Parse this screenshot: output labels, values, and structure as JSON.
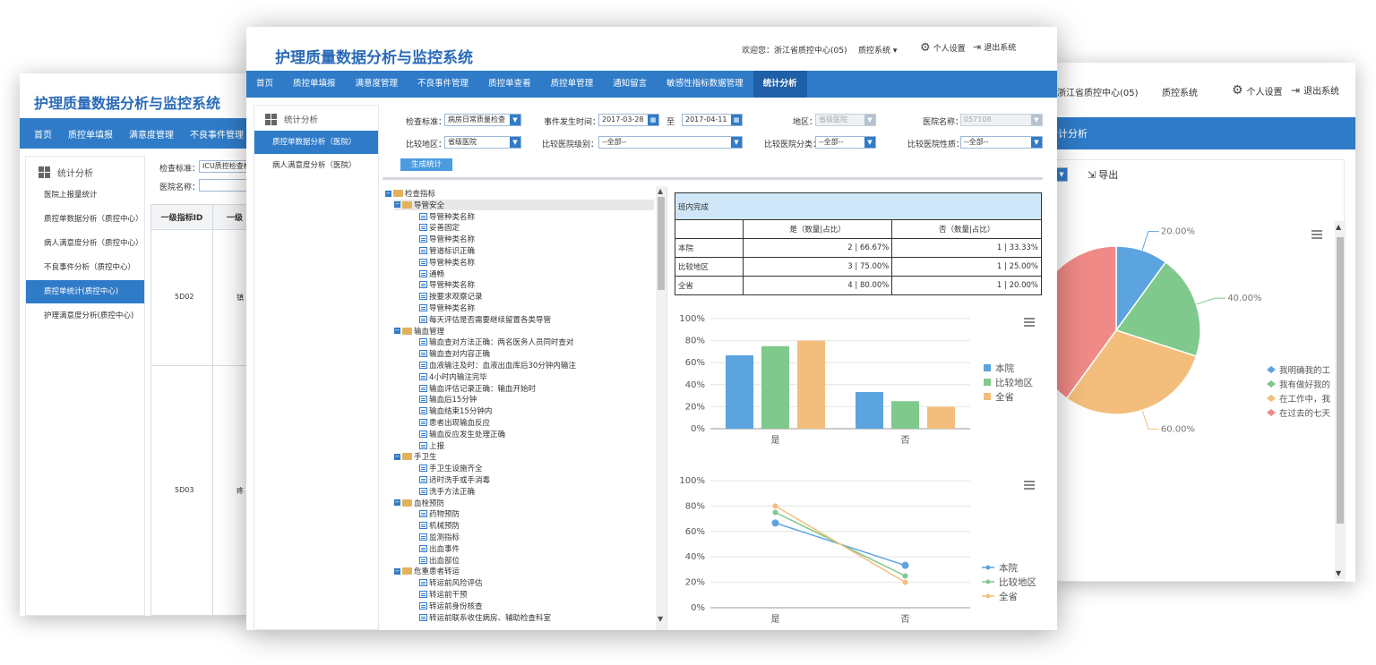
{
  "app_title": "护理质量数据分析与监控系统",
  "header": {
    "welcome": "欢迎您：浙江省质控中心(05)",
    "system_menu": "质控系统",
    "right_welcome": "浙江省质控中心(05)",
    "personal": "个人设置",
    "logout": "退出系统"
  },
  "nav": {
    "items": [
      "首页",
      "质控单填报",
      "满意度管理",
      "不良事件管理",
      "质控单查看",
      "质控单管理",
      "通知留言",
      "敏感性指标数据管理",
      "统计分析"
    ],
    "active_index": 8
  },
  "left_window": {
    "nav": [
      "首页",
      "质控单填报",
      "满意度管理",
      "不良事件管理"
    ],
    "sidebar_title": "统计分析",
    "sidebar_items": [
      "医院上报量统计",
      "质控单数据分析（质控中心）",
      "病人满意度分析（质控中心）",
      "不良事件分析（质控中心）",
      "质控单统计(质控中心)",
      "护理满意度分析(质控中心)"
    ],
    "active_index": 4,
    "filter_label": "检查标准：",
    "filter_value": "ICU质控检查标",
    "hospital_label": "医院名称：",
    "col1": "一级指标ID",
    "col2": "一级",
    "rows": [
      {
        "id": "5D02",
        "name": "镇"
      },
      {
        "id": "5D03",
        "name": "疼"
      }
    ]
  },
  "center_window": {
    "sidebar_title": "统计分析",
    "sidebar_items": [
      "质控单数据分析（医院）",
      "病人满意度分析（医院）"
    ],
    "active_index": 0,
    "filters": {
      "standard_label": "检查标准：",
      "standard_value": "病房日常质量检查",
      "time_label": "事件发生时间：",
      "date_from": "2017-03-28",
      "to_label": "至",
      "date_to": "2017-04-11",
      "region_label": "地区：",
      "region_value": "省级医院",
      "hospital_label": "医院名称：",
      "hospital_value": "057108",
      "compare_region_label": "比较地区：",
      "compare_region_value": "省级医院",
      "compare_level_label": "比较医院级别：",
      "compare_level_value": "--全部--",
      "compare_class_label": "比较医院分类：",
      "compare_class_value": "--全部--",
      "compare_nature_label": "比较医院性质：",
      "compare_nature_value": "--全部--",
      "generate_button": "生成统计"
    },
    "tree": [
      {
        "level": 0,
        "type": "folder",
        "text": "检查指标"
      },
      {
        "level": 1,
        "type": "folder",
        "text": "导管安全"
      },
      {
        "level": 2,
        "type": "doc",
        "text": "导管种类名称"
      },
      {
        "level": 2,
        "type": "doc",
        "text": "妥善固定"
      },
      {
        "level": 2,
        "type": "doc",
        "text": "导管种类名称"
      },
      {
        "level": 2,
        "type": "doc",
        "text": "管道标识正确"
      },
      {
        "level": 2,
        "type": "doc",
        "text": "导管种类名称"
      },
      {
        "level": 2,
        "type": "doc",
        "text": "通畅"
      },
      {
        "level": 2,
        "type": "doc",
        "text": "导管种类名称"
      },
      {
        "level": 2,
        "type": "doc",
        "text": "按要求观察记录"
      },
      {
        "level": 2,
        "type": "doc",
        "text": "导管种类名称"
      },
      {
        "level": 2,
        "type": "doc",
        "text": "每天评估是否需要继续留置各类导管"
      },
      {
        "level": 1,
        "type": "folder",
        "text": "输血管理"
      },
      {
        "level": 2,
        "type": "doc",
        "text": "输血查对方法正确：两名医务人员同时查对"
      },
      {
        "level": 2,
        "type": "doc",
        "text": "输血查对内容正确"
      },
      {
        "level": 2,
        "type": "doc",
        "text": "血液输注及时：血液出血库后30分钟内输注"
      },
      {
        "level": 2,
        "type": "doc",
        "text": "4小时内输注完毕"
      },
      {
        "level": 2,
        "type": "doc",
        "text": "输血评估记录正确：输血开始时"
      },
      {
        "level": 2,
        "type": "doc",
        "text": "输血后15分钟"
      },
      {
        "level": 2,
        "type": "doc",
        "text": "输血结束15分钟内"
      },
      {
        "level": 2,
        "type": "doc",
        "text": "患者出现输血反应"
      },
      {
        "level": 2,
        "type": "doc",
        "text": "输血反应发生处理正确"
      },
      {
        "level": 2,
        "type": "doc",
        "text": "上报"
      },
      {
        "level": 1,
        "type": "folder",
        "text": "手卫生"
      },
      {
        "level": 2,
        "type": "doc",
        "text": "手卫生设施齐全"
      },
      {
        "level": 2,
        "type": "doc",
        "text": "适时洗手或手消毒"
      },
      {
        "level": 2,
        "type": "doc",
        "text": "洗手方法正确"
      },
      {
        "level": 1,
        "type": "folder",
        "text": "血栓预防"
      },
      {
        "level": 2,
        "type": "doc",
        "text": "药物预防"
      },
      {
        "level": 2,
        "type": "doc",
        "text": "机械预防"
      },
      {
        "level": 2,
        "type": "doc",
        "text": "监测指标"
      },
      {
        "level": 2,
        "type": "doc",
        "text": "出血事件"
      },
      {
        "level": 2,
        "type": "doc",
        "text": "出血部位"
      },
      {
        "level": 1,
        "type": "folder",
        "text": "危重患者转运"
      },
      {
        "level": 2,
        "type": "doc",
        "text": "转运前风险评估"
      },
      {
        "level": 2,
        "type": "doc",
        "text": "转运前干预"
      },
      {
        "level": 2,
        "type": "doc",
        "text": "转运前身份核查"
      },
      {
        "level": 2,
        "type": "doc",
        "text": "转运前联系收住病房、辅助检查科室"
      }
    ],
    "table": {
      "title": "班内完成",
      "headers": [
        "",
        "是（数量|占比）",
        "否（数量|占比）"
      ],
      "rows": [
        [
          "本院",
          "2 | 66.67%",
          "1 | 33.33%"
        ],
        [
          "比较地区",
          "3 | 75.00%",
          "1 | 25.00%"
        ],
        [
          "全省",
          "4 | 80.00%",
          "1 | 20.00%"
        ]
      ]
    }
  },
  "right_window": {
    "nav_label": "计分析",
    "export_label": "导出"
  },
  "chart_data": [
    {
      "type": "bar",
      "categories": [
        "是",
        "否"
      ],
      "series": [
        {
          "name": "本院",
          "values": [
            66.67,
            33.33
          ],
          "color": "#5ba4e0"
        },
        {
          "name": "比较地区",
          "values": [
            75.0,
            25.0
          ],
          "color": "#7fc98c"
        },
        {
          "name": "全省",
          "values": [
            80.0,
            20.0
          ],
          "color": "#f3be7c"
        }
      ],
      "ylim": [
        0,
        100
      ],
      "yticks": [
        "0%",
        "20%",
        "40%",
        "60%",
        "80%",
        "100%"
      ]
    },
    {
      "type": "line",
      "categories": [
        "是",
        "否"
      ],
      "series": [
        {
          "name": "本院",
          "values": [
            66.67,
            33.33
          ],
          "color": "#5ba4e0"
        },
        {
          "name": "比较地区",
          "values": [
            75.0,
            25.0
          ],
          "color": "#7fc98c"
        },
        {
          "name": "全省",
          "values": [
            80.0,
            20.0
          ],
          "color": "#f3be7c"
        }
      ],
      "ylim": [
        0,
        100
      ],
      "yticks": [
        "0%",
        "20%",
        "40%",
        "60%",
        "80%",
        "100%"
      ]
    },
    {
      "type": "pie",
      "slices": [
        {
          "label": "20.00%",
          "value": 10,
          "color": "#5ba4e0"
        },
        {
          "label": "40.00%",
          "value": 20,
          "color": "#7fc98c"
        },
        {
          "label": "60.00%",
          "value": 30,
          "color": "#f3be7c"
        },
        {
          "label": "",
          "value": 40,
          "color": "#f08a87"
        }
      ],
      "legend": [
        "我明确我的工",
        "我有做好我的",
        "在工作中，我",
        "在过去的七天"
      ]
    }
  ]
}
